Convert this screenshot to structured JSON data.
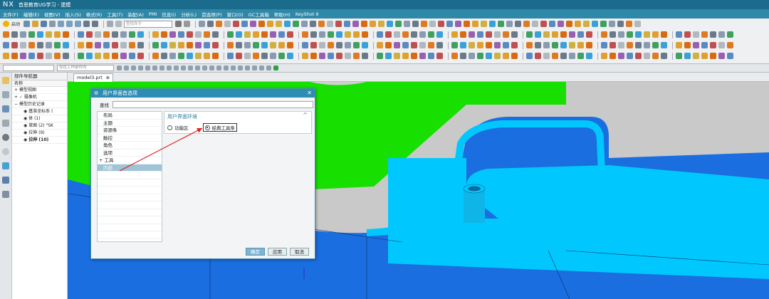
{
  "window": {
    "logo": "NX",
    "title": "首思教育UG学习 - 建模"
  },
  "menu": [
    "文件(F)",
    "编辑(E)",
    "视图(V)",
    "插入(S)",
    "格式(R)",
    "工具(T)",
    "装配(A)",
    "PMI",
    "信息(I)",
    "分析(L)",
    "首选项(P)",
    "窗口(O)",
    "GC工具箱",
    "帮助(H)",
    "KeyShot 9"
  ],
  "toolbar": {
    "start_label": "启动",
    "search_placeholder": "查找命令"
  },
  "selection": {
    "filter_value": "",
    "scope_value": "仅在工作部件内"
  },
  "nav": {
    "title": "部件导航器",
    "column": "名称",
    "items": [
      "模型视图",
      "摄像机",
      "模型历史记录",
      "基准坐标系 (",
      "体 (1)",
      "草图 (2) \"SK",
      "拉伸 (9)",
      "拉伸 (10)"
    ]
  },
  "viewport": {
    "tab_label": "model3.prt"
  },
  "dialog": {
    "title": "用户界面首选项",
    "search_label": "查找",
    "categories": [
      "布局",
      "主题",
      "资源条",
      "触控",
      "角色",
      "选项",
      "工具",
      "内部"
    ],
    "selected_category": "内部",
    "section_title": "用户界面环境",
    "options": [
      "功能区",
      "经典工具条"
    ],
    "selected_option": "经典工具条",
    "buttons": {
      "ok": "确定",
      "apply": "应用",
      "cancel": "取消"
    }
  },
  "colors": {
    "green": "#17e000",
    "cyan": "#00c8ff",
    "blue": "#1a6ee0",
    "titlebar": "#1b6b8c",
    "dialog_title": "#2e8cb3",
    "annotation_arrow": "#e02020"
  }
}
